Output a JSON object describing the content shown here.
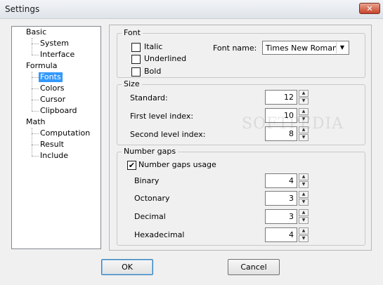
{
  "window": {
    "title": "Settings",
    "close_glyph": "✕"
  },
  "tree": {
    "items": [
      {
        "label": "Basic"
      },
      {
        "label": "System"
      },
      {
        "label": "Interface"
      },
      {
        "label": "Formula"
      },
      {
        "label": "Fonts"
      },
      {
        "label": "Colors"
      },
      {
        "label": "Cursor"
      },
      {
        "label": "Clipboard"
      },
      {
        "label": "Math"
      },
      {
        "label": "Computation"
      },
      {
        "label": "Result"
      },
      {
        "label": "Include"
      }
    ],
    "selected": "Fonts"
  },
  "font_group": {
    "legend": "Font",
    "italic": {
      "label": "Italic",
      "checked": false
    },
    "underlined": {
      "label": "Underlined",
      "checked": false
    },
    "bold": {
      "label": "Bold",
      "checked": false
    },
    "font_name_label": "Font name:",
    "font_name_value": "Times New Roman"
  },
  "size_group": {
    "legend": "Size",
    "standard": {
      "label": "Standard:",
      "value": "12"
    },
    "first_level": {
      "label": "First level index:",
      "value": "10"
    },
    "second_level": {
      "label": "Second level index:",
      "value": "8"
    }
  },
  "gaps_group": {
    "legend": "Number gaps",
    "usage": {
      "label": "Number gaps usage",
      "checked": true,
      "check_glyph": "✔"
    },
    "binary": {
      "label": "Binary",
      "value": "4"
    },
    "octonary": {
      "label": "Octonary",
      "value": "3"
    },
    "decimal": {
      "label": "Decimal",
      "value": "3"
    },
    "hexadecimal": {
      "label": "Hexadecimal",
      "value": "4"
    }
  },
  "spin_glyphs": {
    "up": "▲",
    "down": "▼",
    "dropdown": "▼"
  },
  "buttons": {
    "ok": "OK",
    "cancel": "Cancel"
  },
  "watermark": "SOFTPEDIA"
}
